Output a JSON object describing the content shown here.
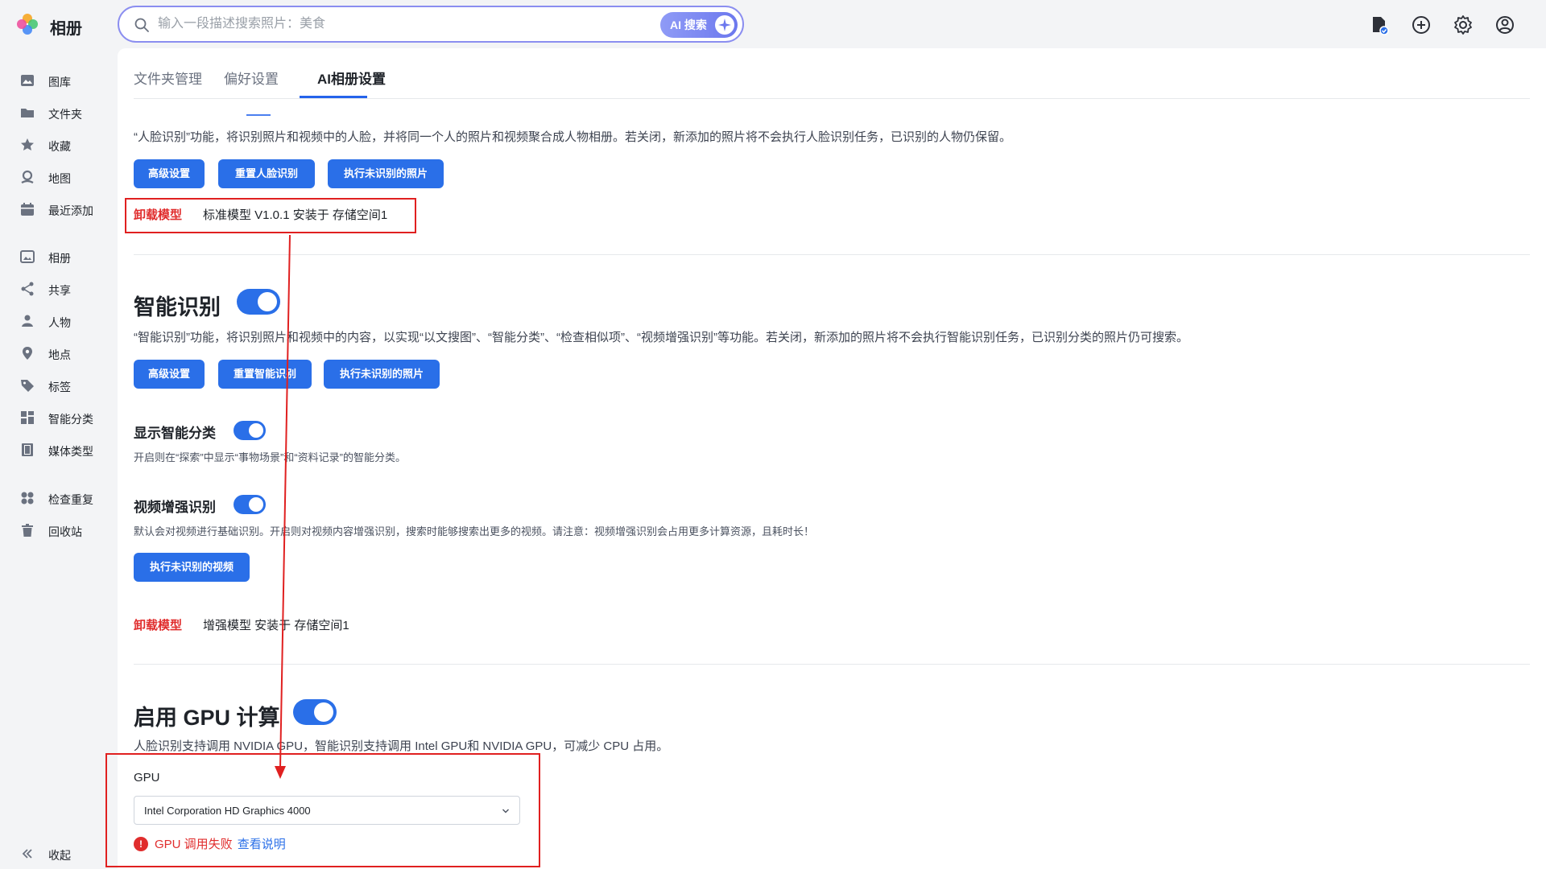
{
  "app": {
    "title": "相册"
  },
  "search": {
    "placeholder": "输入一段描述搜索照片：美食",
    "ai_label": "AI 搜索"
  },
  "top_icons": [
    "task-icon",
    "add-icon",
    "settings-icon",
    "account-icon"
  ],
  "sidebar": {
    "items": [
      {
        "label": "图库",
        "icon": "gallery-icon"
      },
      {
        "label": "文件夹",
        "icon": "folder-icon"
      },
      {
        "label": "收藏",
        "icon": "star-icon"
      },
      {
        "label": "地图",
        "icon": "map-icon"
      },
      {
        "label": "最近添加",
        "icon": "calendar-icon"
      },
      {
        "label": "相册",
        "icon": "album-icon"
      },
      {
        "label": "共享",
        "icon": "share-icon"
      },
      {
        "label": "人物",
        "icon": "person-icon"
      },
      {
        "label": "地点",
        "icon": "location-icon"
      },
      {
        "label": "标签",
        "icon": "tag-icon"
      },
      {
        "label": "智能分类",
        "icon": "grid-icon"
      },
      {
        "label": "媒体类型",
        "icon": "film-icon"
      },
      {
        "label": "检查重复",
        "icon": "duplicate-icon"
      },
      {
        "label": "回收站",
        "icon": "trash-icon"
      }
    ],
    "collapse_label": "收起"
  },
  "tabs": [
    {
      "label": "文件夹管理",
      "active": false
    },
    {
      "label": "偏好设置",
      "active": false
    },
    {
      "label": "AI相册设置",
      "active": true
    }
  ],
  "face": {
    "description": "“人脸识别”功能，将识别照片和视频中的人脸，并将同一个人的照片和视频聚合成人物相册。若关闭，新添加的照片将不会执行人脸识别任务，已识别的人物仍保留。",
    "buttons": [
      "高级设置",
      "重置人脸识别",
      "执行未识别的照片"
    ],
    "uninstall_label": "卸载模型",
    "model_info": "标准模型 V1.0.1 安装于 存储空间1"
  },
  "smart": {
    "title": "智能识别",
    "enabled": true,
    "description": "“智能识别”功能，将识别照片和视频中的内容，以实现“以文搜图”、“智能分类”、“检查相似项”、“视频增强识别”等功能。若关闭，新添加的照片将不会执行智能识别任务，已识别分类的照片仍可搜索。",
    "buttons": [
      "高级设置",
      "重置智能识别",
      "执行未识别的照片"
    ],
    "show_category": {
      "title": "显示智能分类",
      "enabled": true,
      "description": "开启则在“探索”中显示“事物场景”和“资料记录”的智能分类。"
    },
    "video": {
      "title": "视频增强识别",
      "enabled": true,
      "description": "默认会对视频进行基础识别。开启则对视频内容增强识别，搜索时能够搜索出更多的视频。请注意：视频增强识别会占用更多计算资源，且耗时长！",
      "button": "执行未识别的视频"
    },
    "uninstall_label": "卸载模型",
    "model_info": "增强模型 安装于 存储空间1"
  },
  "gpu": {
    "title": "启用 GPU 计算",
    "enabled": true,
    "description": "人脸识别支持调用 NVIDIA GPU，智能识别支持调用 Intel GPU和 NVIDIA GPU，可减少 CPU 占用。",
    "label": "GPU",
    "selected": "Intel Corporation HD Graphics 4000",
    "error": "GPU 调用失败",
    "error_link": "查看说明"
  },
  "colors": {
    "accent": "#2a6fe8",
    "danger": "#e02d2d",
    "annotation": "#e02020"
  }
}
